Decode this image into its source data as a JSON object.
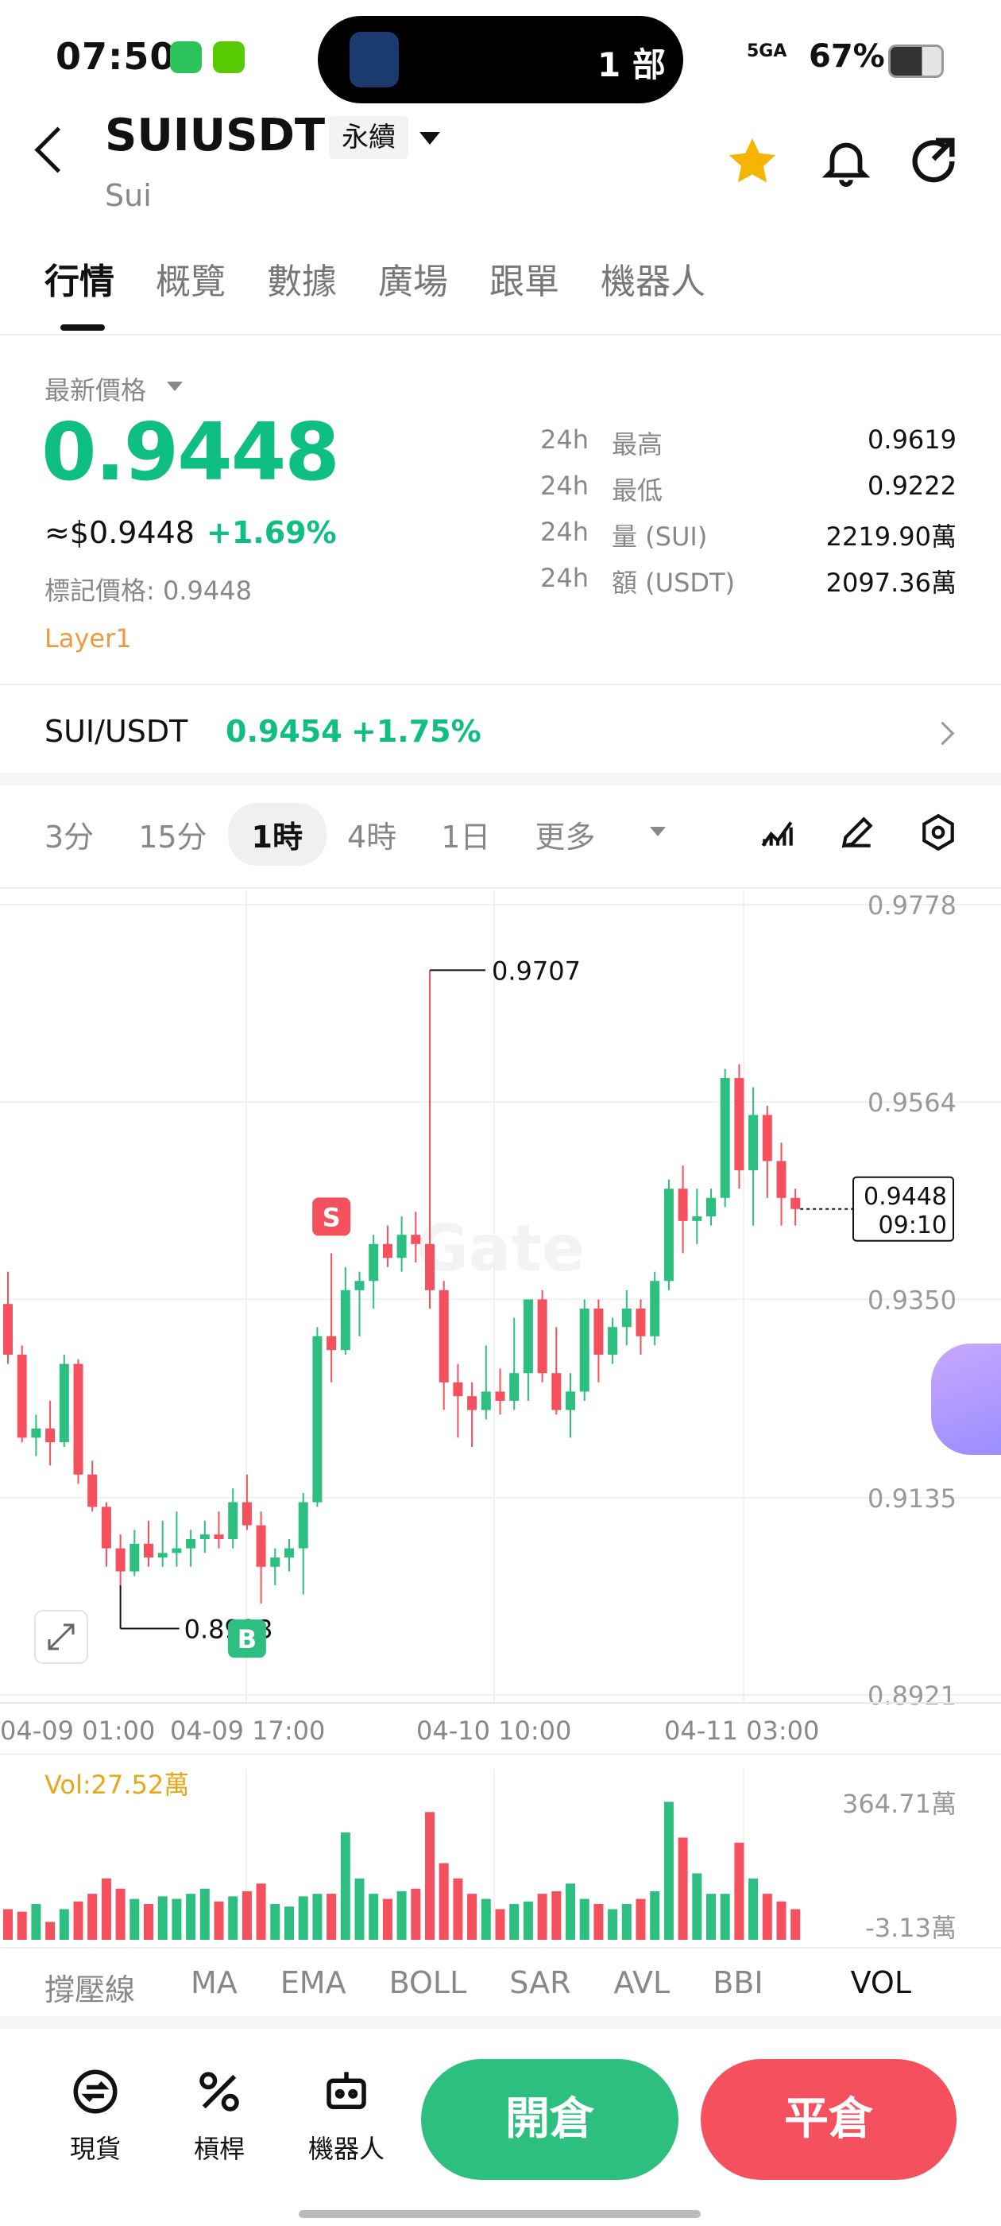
{
  "status": {
    "time": "07:50",
    "island_text": "1 部",
    "network": "5GA",
    "battery": "67%"
  },
  "header": {
    "symbol": "SUIUSDT",
    "contract_type": "永續",
    "name": "Sui"
  },
  "tabs": [
    "行情",
    "概覽",
    "數據",
    "廣場",
    "跟單",
    "機器人"
  ],
  "price": {
    "latest_label": "最新價格",
    "last": "0.9448",
    "usd": "≈$0.9448",
    "change": "+1.69%",
    "mark_price": "標記價格: 0.9448",
    "tag": "Layer1"
  },
  "stats": [
    {
      "period": "24h",
      "label": "最高",
      "value": "0.9619"
    },
    {
      "period": "24h",
      "label": "最低",
      "value": "0.9222"
    },
    {
      "period": "24h",
      "label": "量 (SUI)",
      "value": "2219.90萬"
    },
    {
      "period": "24h",
      "label": "額 (USDT)",
      "value": "2097.36萬"
    }
  ],
  "pair": {
    "name": "SUI/USDT",
    "price": "0.9454",
    "change": "+1.75%"
  },
  "intervals": [
    "3分",
    "15分",
    "1時",
    "4時",
    "1日",
    "更多"
  ],
  "active_interval": "1時",
  "colors": {
    "up": "#2dbf7f",
    "down": "#f5505e",
    "accent": "#0fbf82"
  },
  "chart_data": {
    "type": "candlestick",
    "y_ticks": [
      "0.9778",
      "0.9564",
      "0.9350",
      "0.9135",
      "0.8921"
    ],
    "ylim": [
      0.8921,
      0.9778
    ],
    "x_ticks": [
      "04-09 01:00",
      "04-09 17:00",
      "04-10 10:00",
      "04-11 03:00"
    ],
    "high_label": "0.9707",
    "low_label": "0.8993",
    "current_price": "0.9448",
    "current_countdown": "09:10",
    "sell_marker": "S",
    "buy_marker": "B",
    "candles": [
      [
        0.9345,
        0.938,
        0.928,
        0.929
      ],
      [
        0.929,
        0.93,
        0.9195,
        0.92
      ],
      [
        0.92,
        0.9225,
        0.918,
        0.921
      ],
      [
        0.921,
        0.924,
        0.917,
        0.9195
      ],
      [
        0.9195,
        0.929,
        0.919,
        0.928
      ],
      [
        0.928,
        0.9285,
        0.915,
        0.916
      ],
      [
        0.916,
        0.9175,
        0.912,
        0.9125
      ],
      [
        0.9125,
        0.913,
        0.906,
        0.908
      ],
      [
        0.908,
        0.9095,
        0.904,
        0.9055
      ],
      [
        0.9055,
        0.91,
        0.905,
        0.9085
      ],
      [
        0.9085,
        0.911,
        0.906,
        0.907
      ],
      [
        0.907,
        0.911,
        0.906,
        0.9075
      ],
      [
        0.9075,
        0.912,
        0.906,
        0.908
      ],
      [
        0.908,
        0.91,
        0.906,
        0.909
      ],
      [
        0.909,
        0.911,
        0.9075,
        0.9095
      ],
      [
        0.9095,
        0.912,
        0.908,
        0.909
      ],
      [
        0.909,
        0.9145,
        0.908,
        0.913
      ],
      [
        0.913,
        0.916,
        0.91,
        0.9105
      ],
      [
        0.9105,
        0.912,
        0.902,
        0.906
      ],
      [
        0.906,
        0.908,
        0.904,
        0.907
      ],
      [
        0.907,
        0.909,
        0.9055,
        0.908
      ],
      [
        0.908,
        0.914,
        0.903,
        0.913
      ],
      [
        0.913,
        0.932,
        0.9125,
        0.931
      ],
      [
        0.931,
        0.94,
        0.926,
        0.9295
      ],
      [
        0.9295,
        0.9385,
        0.929,
        0.936
      ],
      [
        0.936,
        0.938,
        0.931,
        0.937
      ],
      [
        0.937,
        0.942,
        0.934,
        0.941
      ],
      [
        0.941,
        0.943,
        0.9385,
        0.9395
      ],
      [
        0.9395,
        0.944,
        0.938,
        0.942
      ],
      [
        0.942,
        0.9445,
        0.939,
        0.941
      ],
      [
        0.941,
        0.9707,
        0.934,
        0.936
      ],
      [
        0.936,
        0.937,
        0.923,
        0.926
      ],
      [
        0.926,
        0.928,
        0.92,
        0.9245
      ],
      [
        0.9245,
        0.926,
        0.919,
        0.923
      ],
      [
        0.923,
        0.93,
        0.922,
        0.925
      ],
      [
        0.925,
        0.9275,
        0.9225,
        0.924
      ],
      [
        0.924,
        0.933,
        0.923,
        0.927
      ],
      [
        0.927,
        0.935,
        0.924,
        0.935
      ],
      [
        0.935,
        0.936,
        0.926,
        0.927
      ],
      [
        0.927,
        0.932,
        0.9225,
        0.923
      ],
      [
        0.923,
        0.927,
        0.92,
        0.925
      ],
      [
        0.925,
        0.935,
        0.924,
        0.934
      ],
      [
        0.934,
        0.935,
        0.926,
        0.929
      ],
      [
        0.929,
        0.933,
        0.928,
        0.932
      ],
      [
        0.932,
        0.936,
        0.93,
        0.934
      ],
      [
        0.934,
        0.935,
        0.929,
        0.931
      ],
      [
        0.931,
        0.938,
        0.93,
        0.937
      ],
      [
        0.937,
        0.948,
        0.936,
        0.947
      ],
      [
        0.947,
        0.9495,
        0.94,
        0.9435
      ],
      [
        0.9435,
        0.947,
        0.941,
        0.944
      ],
      [
        0.944,
        0.947,
        0.943,
        0.946
      ],
      [
        0.946,
        0.96,
        0.945,
        0.959
      ],
      [
        0.959,
        0.9605,
        0.947,
        0.949
      ],
      [
        0.949,
        0.958,
        0.943,
        0.955
      ],
      [
        0.955,
        0.956,
        0.946,
        0.95
      ],
      [
        0.95,
        0.952,
        0.943,
        0.946
      ],
      [
        0.946,
        0.947,
        0.943,
        0.9448
      ]
    ],
    "vol_label": "Vol:27.52萬",
    "vol_ticks": [
      "364.71萬",
      "-3.13萬"
    ],
    "volumes": [
      60,
      55,
      70,
      35,
      60,
      75,
      90,
      120,
      100,
      80,
      70,
      85,
      80,
      90,
      100,
      75,
      85,
      95,
      110,
      70,
      65,
      85,
      90,
      90,
      210,
      120,
      90,
      80,
      95,
      100,
      250,
      150,
      120,
      90,
      80,
      60,
      70,
      75,
      90,
      95,
      110,
      80,
      70,
      60,
      70,
      80,
      95,
      270,
      200,
      130,
      90,
      90,
      190,
      120,
      90,
      75,
      60
    ]
  },
  "indicators": [
    "撐壓線",
    "MA",
    "EMA",
    "BOLL",
    "SAR",
    "AVL",
    "BBI",
    "VOL"
  ],
  "bottom": {
    "nav": [
      "現貨",
      "槓桿",
      "機器人"
    ],
    "open_btn": "開倉",
    "close_btn": "平倉"
  }
}
